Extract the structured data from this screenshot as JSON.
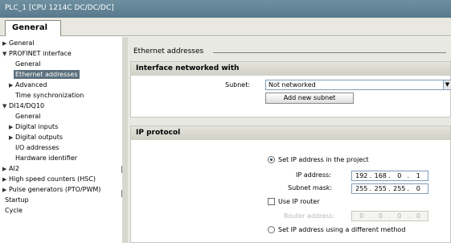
{
  "window": {
    "title": "PLC_1 [CPU 1214C DC/DC/DC]"
  },
  "tabs": [
    {
      "label": "General"
    }
  ],
  "sidebar": {
    "items": [
      {
        "label": "General",
        "arrow": "▶"
      },
      {
        "label": "PROFINET interface",
        "arrow": "▼"
      },
      {
        "label": "General",
        "arrow": ""
      },
      {
        "label": "Ethernet addresses",
        "arrow": ""
      },
      {
        "label": "Advanced",
        "arrow": "▶"
      },
      {
        "label": "Time synchronization",
        "arrow": ""
      },
      {
        "label": "DI14/DQ10",
        "arrow": "▼"
      },
      {
        "label": "General",
        "arrow": ""
      },
      {
        "label": "Digital inputs",
        "arrow": "▶"
      },
      {
        "label": "Digital outputs",
        "arrow": "▶"
      },
      {
        "label": "I/O addresses",
        "arrow": ""
      },
      {
        "label": "Hardware identifier",
        "arrow": ""
      },
      {
        "label": "AI2",
        "arrow": "▶"
      },
      {
        "label": "High speed counters (HSC)",
        "arrow": "▶"
      },
      {
        "label": "Pulse generators (PTO/PWM)",
        "arrow": "▶"
      },
      {
        "label": "Startup",
        "arrow": ""
      },
      {
        "label": "Cycle",
        "arrow": ""
      }
    ]
  },
  "main": {
    "section_title": "Ethernet addresses",
    "interface": {
      "title": "Interface networked with",
      "subnet_label": "Subnet:",
      "subnet_value": "Not networked",
      "add_subnet_label": "Add new subnet"
    },
    "ip": {
      "title": "IP protocol",
      "set_in_project_label": "Set IP address in the project",
      "ip_label": "IP address:",
      "ip_octets": [
        "192",
        "168",
        "0",
        "1"
      ],
      "mask_label": "Subnet mask:",
      "mask_octets": [
        "255",
        "255",
        "255",
        "0"
      ],
      "use_router_label": "Use IP router",
      "router_label": "Router address:",
      "router_octets": [
        "0",
        "0",
        "0",
        "0"
      ],
      "different_method_label": "Set IP address using a different method"
    }
  }
}
